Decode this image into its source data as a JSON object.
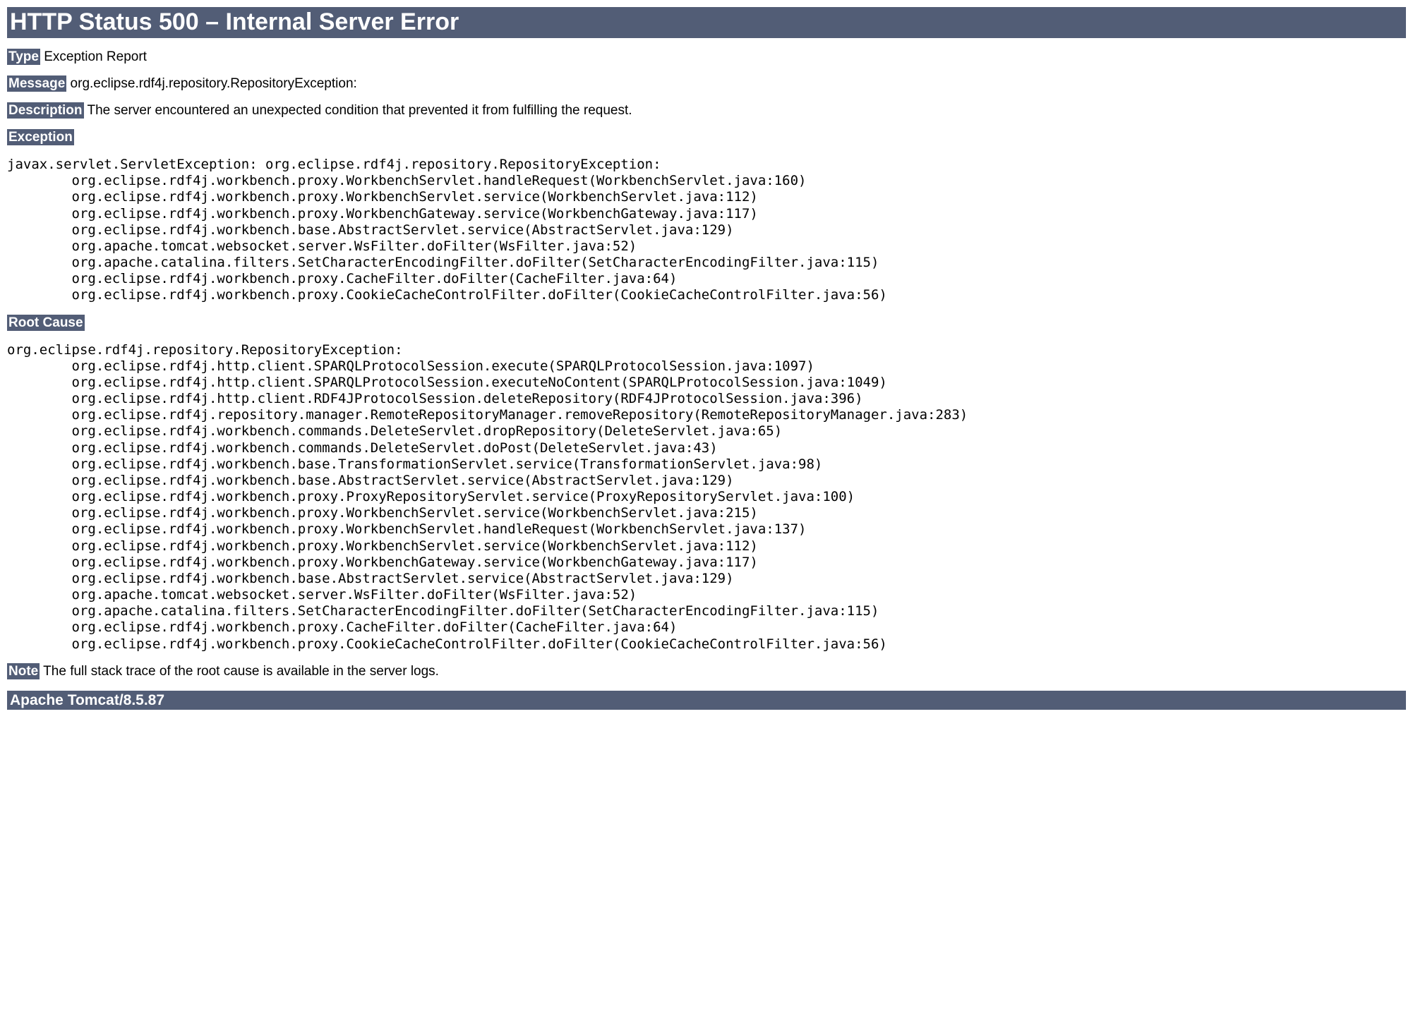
{
  "title": "HTTP Status 500 – Internal Server Error",
  "labels": {
    "type": "Type",
    "message": "Message",
    "description": "Description",
    "exception": "Exception",
    "root_cause": "Root Cause",
    "note": "Note"
  },
  "type_value": " Exception Report",
  "message_value": " org.eclipse.rdf4j.repository.RepositoryException:",
  "description_value": " The server encountered an unexpected condition that prevented it from fulfilling the request.",
  "exception_trace": "javax.servlet.ServletException: org.eclipse.rdf4j.repository.RepositoryException: \n\torg.eclipse.rdf4j.workbench.proxy.WorkbenchServlet.handleRequest(WorkbenchServlet.java:160)\n\torg.eclipse.rdf4j.workbench.proxy.WorkbenchServlet.service(WorkbenchServlet.java:112)\n\torg.eclipse.rdf4j.workbench.proxy.WorkbenchGateway.service(WorkbenchGateway.java:117)\n\torg.eclipse.rdf4j.workbench.base.AbstractServlet.service(AbstractServlet.java:129)\n\torg.apache.tomcat.websocket.server.WsFilter.doFilter(WsFilter.java:52)\n\torg.apache.catalina.filters.SetCharacterEncodingFilter.doFilter(SetCharacterEncodingFilter.java:115)\n\torg.eclipse.rdf4j.workbench.proxy.CacheFilter.doFilter(CacheFilter.java:64)\n\torg.eclipse.rdf4j.workbench.proxy.CookieCacheControlFilter.doFilter(CookieCacheControlFilter.java:56)\n",
  "root_cause_trace": "org.eclipse.rdf4j.repository.RepositoryException: \n\torg.eclipse.rdf4j.http.client.SPARQLProtocolSession.execute(SPARQLProtocolSession.java:1097)\n\torg.eclipse.rdf4j.http.client.SPARQLProtocolSession.executeNoContent(SPARQLProtocolSession.java:1049)\n\torg.eclipse.rdf4j.http.client.RDF4JProtocolSession.deleteRepository(RDF4JProtocolSession.java:396)\n\torg.eclipse.rdf4j.repository.manager.RemoteRepositoryManager.removeRepository(RemoteRepositoryManager.java:283)\n\torg.eclipse.rdf4j.workbench.commands.DeleteServlet.dropRepository(DeleteServlet.java:65)\n\torg.eclipse.rdf4j.workbench.commands.DeleteServlet.doPost(DeleteServlet.java:43)\n\torg.eclipse.rdf4j.workbench.base.TransformationServlet.service(TransformationServlet.java:98)\n\torg.eclipse.rdf4j.workbench.base.AbstractServlet.service(AbstractServlet.java:129)\n\torg.eclipse.rdf4j.workbench.proxy.ProxyRepositoryServlet.service(ProxyRepositoryServlet.java:100)\n\torg.eclipse.rdf4j.workbench.proxy.WorkbenchServlet.service(WorkbenchServlet.java:215)\n\torg.eclipse.rdf4j.workbench.proxy.WorkbenchServlet.handleRequest(WorkbenchServlet.java:137)\n\torg.eclipse.rdf4j.workbench.proxy.WorkbenchServlet.service(WorkbenchServlet.java:112)\n\torg.eclipse.rdf4j.workbench.proxy.WorkbenchGateway.service(WorkbenchGateway.java:117)\n\torg.eclipse.rdf4j.workbench.base.AbstractServlet.service(AbstractServlet.java:129)\n\torg.apache.tomcat.websocket.server.WsFilter.doFilter(WsFilter.java:52)\n\torg.apache.catalina.filters.SetCharacterEncodingFilter.doFilter(SetCharacterEncodingFilter.java:115)\n\torg.eclipse.rdf4j.workbench.proxy.CacheFilter.doFilter(CacheFilter.java:64)\n\torg.eclipse.rdf4j.workbench.proxy.CookieCacheControlFilter.doFilter(CookieCacheControlFilter.java:56)\n",
  "note_value": " The full stack trace of the root cause is available in the server logs.",
  "server": "Apache Tomcat/8.5.87"
}
